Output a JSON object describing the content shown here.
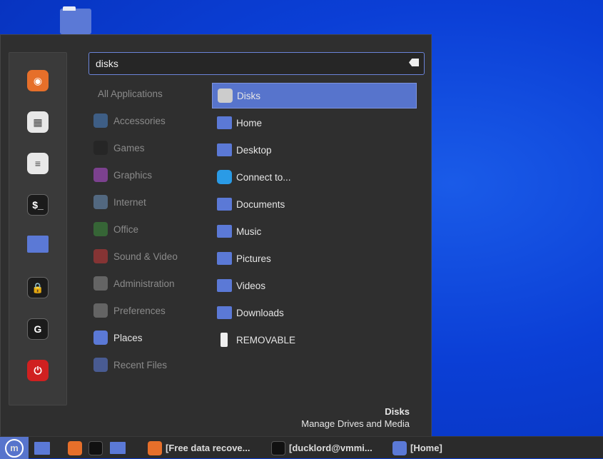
{
  "desktop": {
    "icon": "home-folder-icon"
  },
  "favorites": [
    {
      "name": "firefox",
      "icon": "firefox-icon",
      "color": "#e66f2a"
    },
    {
      "name": "software-manager",
      "icon": "software-manager-icon",
      "color": "#e8e8e8"
    },
    {
      "name": "settings",
      "icon": "settings-icon",
      "color": "#e8e8e8"
    },
    {
      "name": "terminal",
      "icon": "terminal-icon",
      "color": "#1b1b1b"
    },
    {
      "name": "files",
      "icon": "folder-icon",
      "color": "#5b79d6"
    },
    {
      "name": "lock-screen",
      "icon": "lock-icon",
      "color": "#1b1b1b"
    },
    {
      "name": "logout",
      "icon": "logout-icon",
      "color": "#1b1b1b"
    },
    {
      "name": "shutdown",
      "icon": "power-icon",
      "color": "#d02020"
    }
  ],
  "search": {
    "value": "disks"
  },
  "categories": [
    {
      "label": "All Applications",
      "icon": ""
    },
    {
      "label": "Accessories",
      "icon": "accessories-icon",
      "color": "#4a7fc0"
    },
    {
      "label": "Games",
      "icon": "games-icon",
      "color": "#222"
    },
    {
      "label": "Graphics",
      "icon": "graphics-icon",
      "color": "#b04fd0"
    },
    {
      "label": "Internet",
      "icon": "internet-icon",
      "color": "#6a8fb8"
    },
    {
      "label": "Office",
      "icon": "office-icon",
      "color": "#3c8a3c"
    },
    {
      "label": "Sound & Video",
      "icon": "sound-video-icon",
      "color": "#c03838"
    },
    {
      "label": "Administration",
      "icon": "administration-icon",
      "color": "#888"
    },
    {
      "label": "Preferences",
      "icon": "preferences-icon",
      "color": "#888"
    },
    {
      "label": "Places",
      "icon": "places-folder-icon",
      "color": "#5b79d6"
    },
    {
      "label": "Recent Files",
      "icon": "recent-files-icon",
      "color": "#5b79d6"
    }
  ],
  "results": [
    {
      "label": "Disks",
      "icon": "disks-icon"
    },
    {
      "label": "Home",
      "icon": "home-folder-icon"
    },
    {
      "label": "Desktop",
      "icon": "desktop-folder-icon"
    },
    {
      "label": "Connect to...",
      "icon": "cloud-icon"
    },
    {
      "label": "Documents",
      "icon": "documents-folder-icon"
    },
    {
      "label": "Music",
      "icon": "music-folder-icon"
    },
    {
      "label": "Pictures",
      "icon": "pictures-folder-icon"
    },
    {
      "label": "Videos",
      "icon": "videos-folder-icon"
    },
    {
      "label": "Downloads",
      "icon": "downloads-folder-icon"
    },
    {
      "label": "REMOVABLE",
      "icon": "usb-drive-icon"
    }
  ],
  "description": {
    "title": "Disks",
    "subtitle": "Manage Drives and Media"
  },
  "taskbar": {
    "windows": [
      {
        "label": "[Free data recove...",
        "icon": "firefox-icon"
      },
      {
        "label": "[ducklord@vmmi...",
        "icon": "terminal-icon"
      },
      {
        "label": "[Home]",
        "icon": "folder-icon"
      }
    ]
  },
  "accent": "#5774cc"
}
